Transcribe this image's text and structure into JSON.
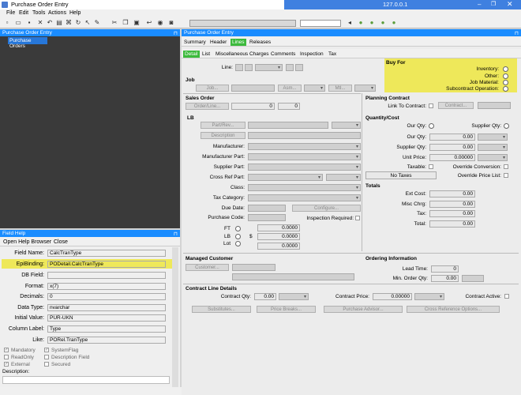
{
  "window": {
    "title": "Purchase Order Entry",
    "remote_ip": "127.0.0.1"
  },
  "menu": [
    "File",
    "Edit",
    "Tools",
    "Actions",
    "Help"
  ],
  "nav": {
    "header": "Purchase Order Entry",
    "item": "Purchase Orders"
  },
  "main_header": "Purchase Order Entry",
  "tabs_top": [
    "Summary",
    "Header",
    "Lines",
    "Releases"
  ],
  "tabs_top_active": "Lines",
  "tabs_sub": [
    "Detail",
    "List",
    "Miscellaneous Charges",
    "Comments",
    "Inspection",
    "Tax"
  ],
  "tabs_sub_active": "Detail",
  "line": {
    "label": "Line:"
  },
  "job": {
    "section": "Job",
    "job_btn": "Job...",
    "asm_btn": "Asm...",
    "mtl_btn": "Mtl..."
  },
  "buy_for": {
    "section": "Buy For",
    "options": [
      "Inventory:",
      "Other:",
      "Job Material:",
      "Subcontract Operation:"
    ]
  },
  "sales_order": {
    "section": "Sales Order",
    "btn": "Order/Line...",
    "v1": "0",
    "v2": "0"
  },
  "planning": {
    "section": "Planning Contract",
    "link_label": "Link To Contract:",
    "btn": "Contract..."
  },
  "lb": {
    "section": "LB",
    "part_btn": "Part/Rev...",
    "desc_btn": "Description",
    "fields": [
      "Manufacturer:",
      "Manufacturer Part:",
      "Supplier Part:",
      "Cross Ref Part:",
      "Class:",
      "Tax Category:"
    ],
    "due_date": "Due Date:",
    "configure_btn": "Configure...",
    "purchase_code": "Purchase Code:",
    "inspection": "Inspection Required:",
    "dims": [
      "FT",
      "LB",
      "Lot"
    ],
    "dim_vals": [
      "0.0000",
      "0.0000",
      "0.0000"
    ],
    "currency": "$"
  },
  "qty": {
    "section": "Quantity/Cost",
    "our_qty_radio": "Our Qty:",
    "supplier_qty_radio": "Supplier Qty:",
    "our_qty": "Our Qty:",
    "our_qty_val": "0.00",
    "supplier_qty": "Supplier Qty:",
    "supplier_qty_val": "0.00",
    "unit_price": "Unit Price:",
    "unit_price_val": "0.00000",
    "taxable": "Taxable:",
    "override_conv": "Override Conversion:",
    "no_taxes": "No Taxes",
    "override_price": "Override Price List:"
  },
  "totals": {
    "section": "Totals",
    "rows": [
      {
        "label": "Ext Cost:",
        "value": "0.00"
      },
      {
        "label": "Misc Chrg:",
        "value": "0.00"
      },
      {
        "label": "Tax:",
        "value": "0.00"
      },
      {
        "label": "Total:",
        "value": "0.00"
      }
    ]
  },
  "managed": {
    "section": "Managed Customer",
    "btn": "Customer..."
  },
  "ordering": {
    "section": "Ordering Information",
    "lead_time": "Lead Time:",
    "lead_val": "0",
    "min_qty": "Min. Order Qty:",
    "min_val": "0.00"
  },
  "contract": {
    "section": "Contract Line Details",
    "qty_label": "Contract Qty:",
    "qty_val": "0.00",
    "price_label": "Contract Price:",
    "price_val": "0.00000",
    "active_label": "Contract Active:",
    "buttons": [
      "Substitutes...",
      "Price Breaks...",
      "Purchase Advisor...",
      "Cross Reference Options..."
    ]
  },
  "field_help": {
    "header": "Field Help",
    "menu": [
      "Open Help Browser",
      "Close"
    ],
    "rows": [
      {
        "label": "Field Name:",
        "value": "CalcTranType"
      },
      {
        "label": "EpiBinding:",
        "value": "PODetail.CalcTranType"
      },
      {
        "label": "DB Field:",
        "value": ""
      },
      {
        "label": "Format:",
        "value": "x(7)"
      },
      {
        "label": "Decimals:",
        "value": "0"
      },
      {
        "label": "Data Type:",
        "value": "nvarchar"
      },
      {
        "label": "Initial Value:",
        "value": "PUR-UKN"
      },
      {
        "label": "Column Label:",
        "value": "Type"
      },
      {
        "label": "Like:",
        "value": "PORel.TranType"
      }
    ],
    "checks_left": [
      "Mandatory",
      "ReadOnly",
      "External"
    ],
    "checks_right": [
      "SystemFlag",
      "Description Field",
      "Secured"
    ],
    "description": "Description:"
  }
}
